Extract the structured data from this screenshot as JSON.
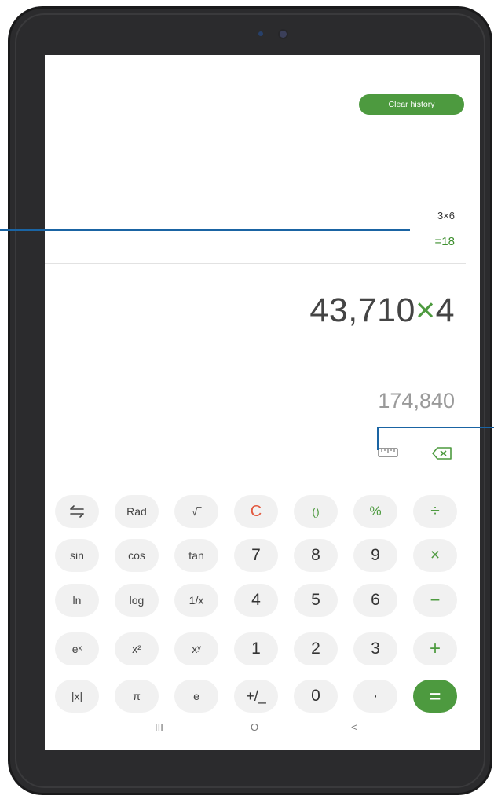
{
  "header": {
    "clear_history_label": "Clear history"
  },
  "history": [
    {
      "expression": "3×6",
      "result": "=18"
    }
  ],
  "display": {
    "expression_left": "43,710",
    "expression_op": "×",
    "expression_right": "4",
    "preview_result": "174,840"
  },
  "keypad": {
    "rows": [
      [
        "⇆",
        "Rad",
        "√‾",
        "C",
        "()",
        "%",
        "÷"
      ],
      [
        "sin",
        "cos",
        "tan",
        "7",
        "8",
        "9",
        "×"
      ],
      [
        "ln",
        "log",
        "1/x",
        "4",
        "5",
        "6",
        "−"
      ],
      [
        "eˣ",
        "x²",
        "xʸ",
        "1",
        "2",
        "3",
        "+"
      ],
      [
        "|x|",
        "π",
        "e",
        "+/_",
        "0",
        "·",
        "="
      ]
    ]
  },
  "navbar": {
    "recents": "III",
    "home": "O",
    "back": "<"
  },
  "icons": {
    "unit_converter": "ruler-icon",
    "backspace": "backspace-icon",
    "swap": "swap-arrows-icon"
  },
  "colors": {
    "accent": "#4d9a3f",
    "clear": "#e2593f",
    "callout": "#1a64a3"
  }
}
